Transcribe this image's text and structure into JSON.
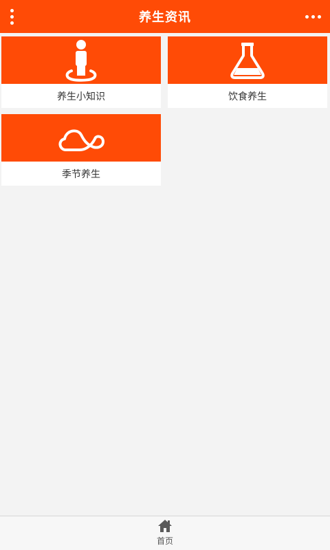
{
  "header": {
    "title": "养生资讯",
    "menu_icon": "vertical-dots-icon",
    "more_icon": "horizontal-dots-icon"
  },
  "tiles": [
    {
      "label": "养生小知识",
      "icon": "person-standing-icon"
    },
    {
      "label": "饮食养生",
      "icon": "flask-icon"
    },
    {
      "label": "季节养生",
      "icon": "cloud-icon"
    }
  ],
  "bottom_nav": {
    "items": [
      {
        "label": "首页",
        "icon": "home-icon"
      }
    ]
  },
  "colors": {
    "accent": "#ff4b06",
    "background": "#f3f3f3",
    "tile_background": "#ffffff",
    "text": "#333333"
  }
}
